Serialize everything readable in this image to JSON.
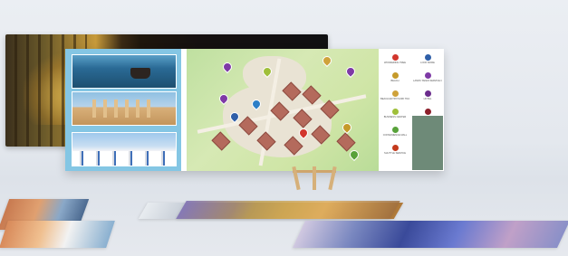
{
  "scene": {
    "background_color": "#e7eaef",
    "legend_items": [
      {
        "label": "WONDERING TREE",
        "color": "#d2362d",
        "icon": "circle-icon"
      },
      {
        "label": "LOOK MORE",
        "color": "#2f5fa8",
        "icon": "circle-icon"
      },
      {
        "label": "BEACH",
        "color": "#c59a2a",
        "icon": "circle-icon"
      },
      {
        "label": "LANDS TAKEN SERVICE CENTER",
        "color": "#7e3aa6",
        "icon": "circle-icon"
      },
      {
        "label": "BEACH ENTRY/SURF TRAIL",
        "color": "#cfa23a",
        "icon": "circle-icon"
      },
      {
        "label": "HOTEL",
        "color": "#6b2c8c",
        "icon": "circle-icon"
      },
      {
        "label": "BUSINESS CENTER",
        "color": "#9fbf3a",
        "icon": "circle-icon"
      },
      {
        "label": "SHOPPING CENTER",
        "color": "#8c1f2a",
        "icon": "circle-icon"
      },
      {
        "label": "CONVENIENCE MALL",
        "color": "#58a23a",
        "icon": "circle-icon"
      },
      {
        "label": "THE ISLAND TOWER",
        "color": "#2c7fc7",
        "icon": "circle-icon"
      },
      {
        "label": "SHUTTLE SERVICE",
        "color": "#c43a1c",
        "icon": "circle-icon"
      },
      {
        "label": "PARKING",
        "color": "#222222",
        "icon": "circle-icon"
      }
    ]
  }
}
